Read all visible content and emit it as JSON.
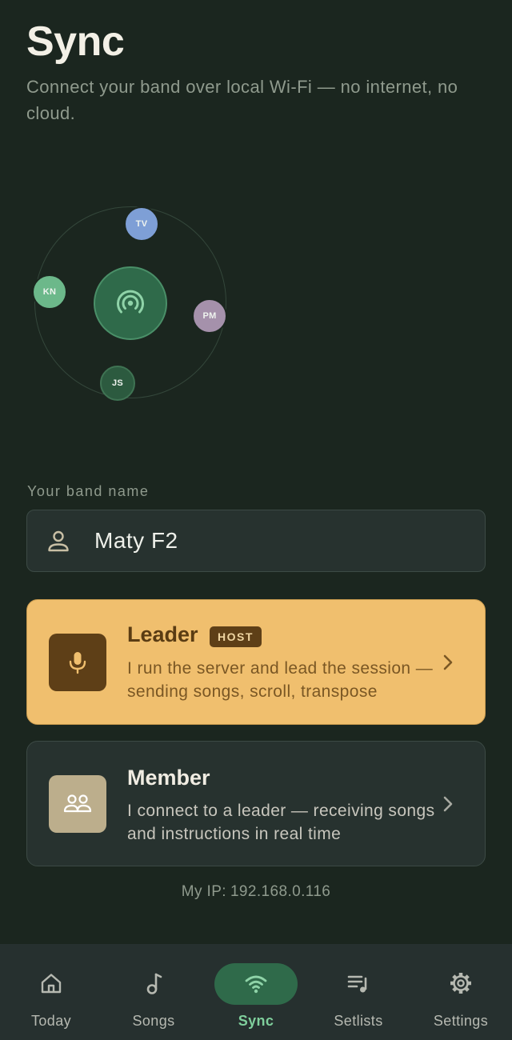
{
  "header": {
    "title": "Sync",
    "subtitle": "Connect your band over local Wi-Fi — no internet, no cloud."
  },
  "network": {
    "hub_icon": "broadcast-icon",
    "peers": [
      {
        "initials": "TV",
        "color": "#7e9fd6"
      },
      {
        "initials": "KN",
        "color": "#6cb88a"
      },
      {
        "initials": "PM",
        "color": "#a591ab"
      },
      {
        "initials": "JS",
        "color": "#2c5a3f"
      }
    ]
  },
  "band": {
    "label": "Your band name",
    "value": "Maty F2",
    "icon": "person-icon"
  },
  "roles": {
    "leader": {
      "title": "Leader",
      "badge": "HOST",
      "description": "I run the server and lead the session — sending songs, scroll, transpose",
      "icon": "microphone-icon"
    },
    "member": {
      "title": "Member",
      "description": "I connect to a leader — receiving songs and instructions in real time",
      "icon": "group-icon"
    }
  },
  "network_info": {
    "ip_label": "My IP:",
    "ip_value": "192.168.0.116"
  },
  "nav": {
    "items": [
      {
        "label": "Today",
        "icon": "home-icon",
        "active": false
      },
      {
        "label": "Songs",
        "icon": "music-note-icon",
        "active": false
      },
      {
        "label": "Sync",
        "icon": "wifi-icon",
        "active": true
      },
      {
        "label": "Setlists",
        "icon": "playlist-icon",
        "active": false
      },
      {
        "label": "Settings",
        "icon": "gear-icon",
        "active": false
      }
    ]
  },
  "colors": {
    "background": "#1b261f",
    "accent_green": "#2f6a4a",
    "leader_card": "#f0bf6e",
    "member_card": "#27322f"
  }
}
